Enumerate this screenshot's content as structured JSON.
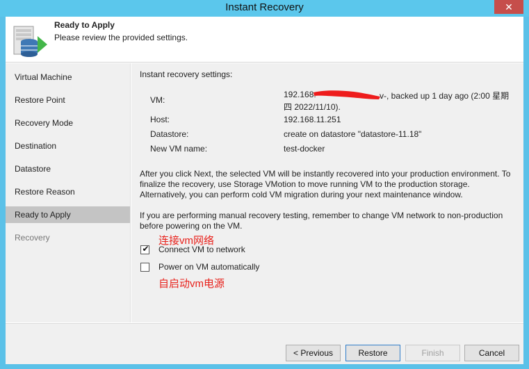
{
  "window": {
    "title": "Instant Recovery",
    "close_glyph": "✕"
  },
  "header": {
    "title": "Ready to Apply",
    "subtitle": "Please review the provided  settings.",
    "icon": "server-database-arrow-icon"
  },
  "sidebar": {
    "items": [
      {
        "label": "Virtual Machine",
        "state": "normal"
      },
      {
        "label": "Restore Point",
        "state": "normal"
      },
      {
        "label": "Recovery Mode",
        "state": "normal"
      },
      {
        "label": "Destination",
        "state": "normal"
      },
      {
        "label": "Datastore",
        "state": "normal"
      },
      {
        "label": "Restore Reason",
        "state": "normal"
      },
      {
        "label": "Ready to Apply",
        "state": "active"
      },
      {
        "label": "Recovery",
        "state": "disabled"
      }
    ]
  },
  "main": {
    "section_title": "Instant recovery settings:",
    "settings": {
      "vm_label": "VM:",
      "vm_value_line1_prefix": "192.168.",
      "vm_value_line1_suffix": "v-, backed up 1 day ago (2:00 星期",
      "vm_value_line2": "四 2022/11/10).",
      "host_label": "Host:",
      "host_value": "192.168.11.251",
      "datastore_label": "Datastore:",
      "datastore_value": "create on datastore \"datastore-11.18\"",
      "newname_label": "New VM name:",
      "newname_value": "test-docker"
    },
    "info_paragraph": "After you click Next, the selected VM will be instantly recovered into your production environment. To finalize the recovery, use Storage VMotion to move running VM to the production storage. Alternatively, you can perform cold VM migration during your next maintenance window.",
    "warning_paragraph": "If you are performing manual recovery testing, remember to change VM network to non-production before powering on the VM.",
    "connect_checkbox": {
      "label": "Connect VM to network",
      "checked": true
    },
    "poweron_checkbox": {
      "label": "Power on VM automatically",
      "checked": false
    },
    "annotations": {
      "connect_note": "连接vm网络",
      "poweron_note": "自启动vm电源"
    }
  },
  "footer": {
    "previous_label": "< Previous",
    "restore_label": "Restore",
    "finish_label": "Finish",
    "cancel_label": "Cancel"
  },
  "colors": {
    "titlebar": "#5bc7ec",
    "close_button": "#c64e4b",
    "active_nav": "#c4c4c4",
    "annotation": "#e8211b",
    "panel": "#f0f0f0"
  }
}
